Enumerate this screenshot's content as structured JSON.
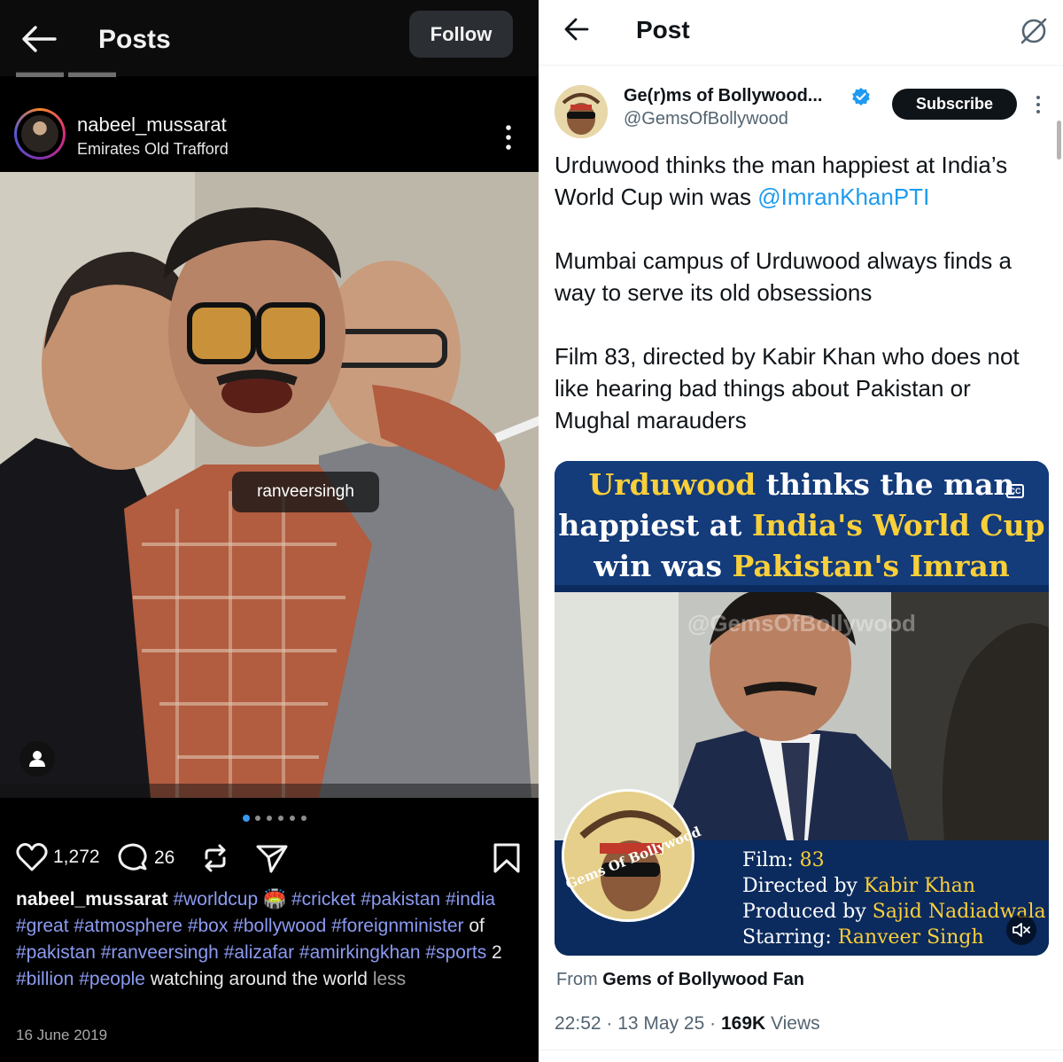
{
  "instagram": {
    "header": {
      "title": "Posts",
      "follow_label": "Follow"
    },
    "post": {
      "username": "nabeel_mussarat",
      "location": "Emirates Old Trafford",
      "photo_tag": "ranveersingh",
      "likes": "1,272",
      "comments": "26",
      "caption": {
        "username": "nabeel_mussarat",
        "parts": [
          {
            "t": "#worldcup",
            "k": "tag"
          },
          {
            "t": " 🏟️ ",
            "k": "text"
          },
          {
            "t": "#cricket",
            "k": "tag"
          },
          {
            "t": " ",
            "k": "text"
          },
          {
            "t": "#pakistan",
            "k": "tag"
          },
          {
            "t": " ",
            "k": "text"
          },
          {
            "t": "#india",
            "k": "tag"
          },
          {
            "t": " ",
            "k": "text"
          },
          {
            "t": "#great",
            "k": "tag"
          },
          {
            "t": " ",
            "k": "text"
          },
          {
            "t": "#atmosphere",
            "k": "tag"
          },
          {
            "t": " ",
            "k": "text"
          },
          {
            "t": "#box",
            "k": "tag"
          },
          {
            "t": " ",
            "k": "text"
          },
          {
            "t": "#bollywood",
            "k": "tag"
          },
          {
            "t": " ",
            "k": "text"
          },
          {
            "t": "#foreignminister",
            "k": "tag"
          },
          {
            "t": " of ",
            "k": "text"
          },
          {
            "t": "#pakistan",
            "k": "tag"
          },
          {
            "t": " ",
            "k": "text"
          },
          {
            "t": "#ranveersingh",
            "k": "tag"
          },
          {
            "t": " ",
            "k": "text"
          },
          {
            "t": "#alizafar",
            "k": "tag"
          },
          {
            "t": " ",
            "k": "text"
          },
          {
            "t": "#amirkingkhan",
            "k": "tag"
          },
          {
            "t": " ",
            "k": "text"
          },
          {
            "t": "#sports",
            "k": "tag"
          },
          {
            "t": " 2 ",
            "k": "text"
          },
          {
            "t": "#billion",
            "k": "tag"
          },
          {
            "t": " ",
            "k": "text"
          },
          {
            "t": "#people",
            "k": "tag"
          },
          {
            "t": " watching around the world ",
            "k": "text"
          },
          {
            "t": "less",
            "k": "less"
          }
        ]
      },
      "date": "16 June 2019",
      "carousel": {
        "count": 6,
        "active": 0
      },
      "icons": {
        "back": "back-arrow-icon",
        "more": "more-vertical-icon",
        "like": "heart-icon",
        "comment": "comment-icon",
        "repost": "repost-icon",
        "share": "send-icon",
        "save": "bookmark-icon",
        "tagged_user": "user-tag-icon"
      }
    }
  },
  "x": {
    "header": {
      "title": "Post"
    },
    "author": {
      "display_name": "Ge(r)ms of Bollywood...",
      "handle": "@GemsOfBollywood",
      "subscribe_label": "Subscribe"
    },
    "tweet": {
      "para1_pre": "Urduwood thinks the man happiest at India’s World Cup win was ",
      "para1_mention": "@ImranKhanPTI",
      "para2": "Mumbai campus of Urduwood always finds a way to serve its old obsessions",
      "para3": "Film 83, directed by Kabir Khan who does not like hearing bad things about Pakistan or Mughal marauders"
    },
    "media": {
      "headline": {
        "l1a": "Urduwood",
        "l1b": " thinks the man",
        "l2a": "happiest at ",
        "l2b": "India's World Cup",
        "l3a": "win was ",
        "l3b": "Pakistan's Imran Khan"
      },
      "watermark": "@GemsOfBollywood",
      "logo_text": "Gems Of Bollywood",
      "credits": {
        "film_label": "Film: ",
        "film_value": "83",
        "dir_label": "Directed by ",
        "dir_value": "Kabir Khan",
        "prod_label": "Produced by ",
        "prod_value": "Sajid Nadiadwala",
        "star_label": "Starring: ",
        "star_value": "Ranveer Singh"
      },
      "cc_label": "CC"
    },
    "from": {
      "prefix": "From ",
      "source": "Gems of Bollywood Fan"
    },
    "meta": {
      "time": "22:52",
      "sep": " · ",
      "date": "13 May 25",
      "views_count": "169K",
      "views_label": " Views"
    },
    "colors": {
      "link": "#1d9bf0",
      "verified": "#1d9bf0",
      "headline_highlight": "#f9cf3a"
    }
  }
}
